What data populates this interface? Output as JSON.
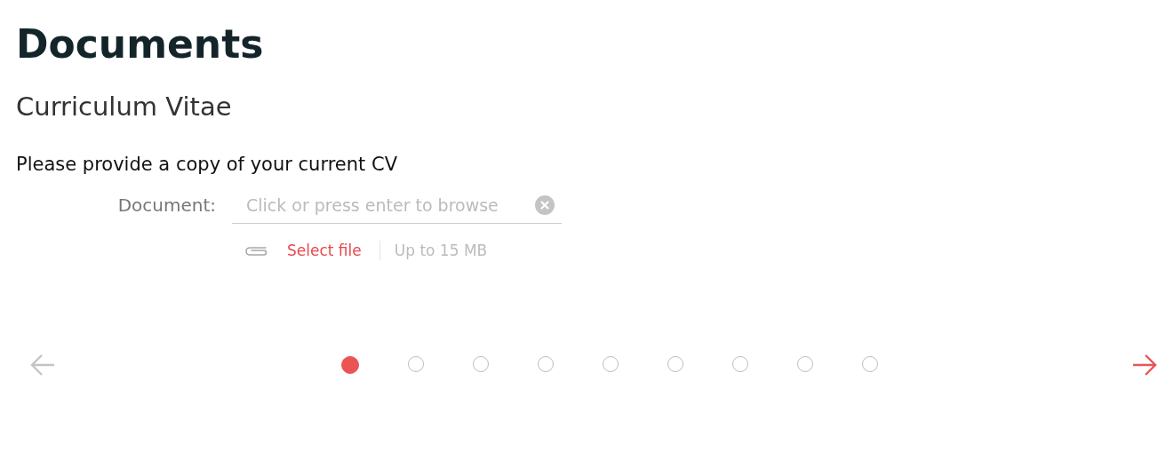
{
  "title": "Documents",
  "section": "Curriculum Vitae",
  "prompt": "Please provide a copy of your current CV",
  "field": {
    "label": "Document:",
    "placeholder": "Click or press enter to browse"
  },
  "upload": {
    "action": "Select file",
    "limit": "Up to 15 MB"
  },
  "pager": {
    "prev": {
      "disabled": true
    },
    "next": {
      "disabled": false
    },
    "steps": [
      {
        "selected": true
      },
      {
        "selected": false
      },
      {
        "selected": false
      },
      {
        "selected": false
      },
      {
        "selected": false
      },
      {
        "selected": false
      },
      {
        "selected": false
      },
      {
        "selected": false
      },
      {
        "selected": false
      }
    ]
  }
}
